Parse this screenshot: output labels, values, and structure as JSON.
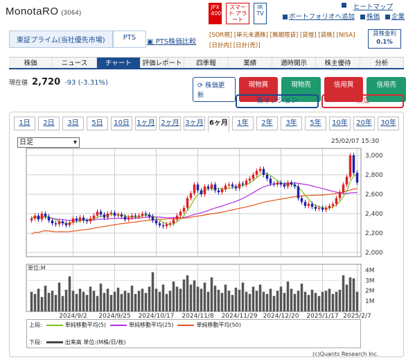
{
  "header": {
    "company": "MonotaRO",
    "code": "(3064)",
    "icons": [
      "JPX 400",
      "スマート アラート",
      "IR TV"
    ],
    "links": [
      "ヒートマップ",
      "ポートフォリオへ追加",
      "株価",
      "企業"
    ]
  },
  "market": {
    "tabs": [
      "東証プライム(当社優先市場)",
      "PTS"
    ],
    "pts_compare": "PTS株価比較",
    "tags_line1": "[SOR規] [単元未満株] [無期限貸] [貸借] [貸株] [NISA]",
    "tags_line2": "[日計内] [日計(売)]",
    "margin_label": "貸株金利",
    "margin_value": "0.1%"
  },
  "nav": {
    "items": [
      "株価",
      "ニュース",
      "チャート",
      "評価レポート",
      "四季報",
      "業績",
      "適時開示",
      "株主優待",
      "分析"
    ],
    "active": 2
  },
  "price": {
    "label": "現在値",
    "value": "2,720",
    "change": "-93 (-3.31%)"
  },
  "buttons": {
    "update": "株価更新",
    "spot_buy": "現物買",
    "spot_sell": "現物売",
    "margin_buy": "信用買",
    "margin_sell": "信用売",
    "option": "株オプション",
    "limit": "積立"
  },
  "periods": {
    "items": [
      "1日",
      "2日",
      "3日",
      "5日",
      "10日",
      "1ヶ月",
      "2ヶ月",
      "3ヶ月",
      "6ヶ月",
      "1年",
      "2年",
      "3年",
      "5年",
      "10年",
      "20年",
      "30年"
    ],
    "active": 8
  },
  "chart_select": "日足",
  "timestamp": "25/02/07 15:30",
  "chart_data": {
    "type": "candlestick",
    "ylim": [
      2000,
      3000
    ],
    "yticks": [
      "3,000",
      "2,800",
      "2,600",
      "2,400",
      "2,200",
      "2,000"
    ],
    "xticks": [
      "2024/9/2",
      "2024/9/25",
      "2024/10/17",
      "2024/11/8",
      "2024/11/29",
      "2024/12/20",
      "2025/1/17",
      "2025/2/7"
    ],
    "volume_label": "単位:M",
    "volume_ticks": [
      "4M",
      "3M",
      "2M",
      "1M"
    ],
    "series": [
      {
        "name": "単純移動平均(5)",
        "color": "#7fbf1f"
      },
      {
        "name": "単純移動平均(25)",
        "color": "#b22ee0"
      },
      {
        "name": "単純移動平均(50)",
        "color": "#e8541a"
      }
    ],
    "closes": [
      2350,
      2380,
      2340,
      2400,
      2370,
      2330,
      2300,
      2290,
      2320,
      2300,
      2280,
      2310,
      2350,
      2330,
      2360,
      2330,
      2320,
      2350,
      2380,
      2420,
      2390,
      2360,
      2400,
      2410,
      2380,
      2390,
      2370,
      2340,
      2360,
      2380,
      2370,
      2380,
      2400,
      2390,
      2370,
      2330,
      2300,
      2280,
      2270,
      2290,
      2300,
      2340,
      2380,
      2420,
      2460,
      2560,
      2610,
      2700,
      2640,
      2600,
      2680,
      2660,
      2700,
      2640,
      2620,
      2650,
      2690,
      2700,
      2680,
      2660,
      2710,
      2700,
      2740,
      2760,
      2800,
      2840,
      2860,
      2800,
      2760,
      2710,
      2700,
      2720,
      2700,
      2680,
      2720,
      2700,
      2680,
      2560,
      2520,
      2480,
      2500,
      2470,
      2450,
      2460,
      2440,
      2460,
      2480,
      2500,
      2560,
      2620,
      2700,
      2780,
      3000,
      2820,
      2720
    ],
    "volumes": [
      1.9,
      1.7,
      2.2,
      1.4,
      2.5,
      1.8,
      2.0,
      1.6,
      2.8,
      1.5,
      2.1,
      3.4,
      2.0,
      1.7,
      2.2,
      1.9,
      1.6,
      2.4,
      2.0,
      1.5,
      2.7,
      1.8,
      2.2,
      1.6,
      1.9,
      2.3,
      1.7,
      2.0,
      1.8,
      2.5,
      1.7,
      2.0,
      2.2,
      1.8,
      2.4,
      3.8,
      2.2,
      1.9,
      2.6,
      1.7,
      2.0,
      2.9,
      2.4,
      2.2,
      3.1,
      3.5,
      2.6,
      3.0,
      2.4,
      2.2,
      2.8,
      1.9,
      3.3,
      2.5,
      2.1,
      1.8,
      2.6,
      2.0,
      1.6,
      2.3,
      2.1,
      2.8,
      1.9,
      1.7,
      2.4,
      2.0,
      2.6,
      1.9,
      1.7,
      2.2,
      1.5,
      2.0,
      2.4,
      1.8,
      2.9,
      2.2,
      1.7,
      2.0,
      2.7,
      1.9,
      1.6,
      2.1,
      1.8,
      1.5,
      1.9,
      2.0,
      2.2,
      1.7,
      1.9,
      2.1,
      3.5,
      2.6,
      3.3,
      3.2,
      1.9
    ]
  },
  "legend": {
    "upper_label": "上段:",
    "lower_label": "下段:",
    "volume_text": "出来高 単位:(M株/日/枚)"
  },
  "copyright": "(c)Quants Research Inc."
}
